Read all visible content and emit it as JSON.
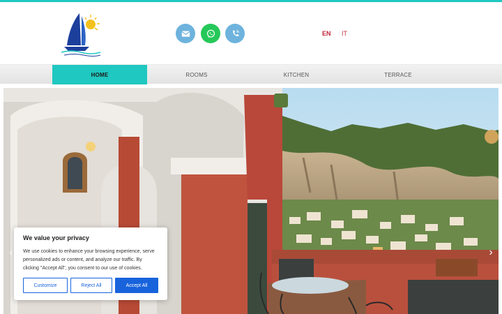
{
  "colors": {
    "accent": "#1fc8c0",
    "language_active": "#c0283c",
    "mail_button": "#6db3dd",
    "whatsapp_button": "#26c85a",
    "phone_button": "#6db3dd",
    "cookie_primary": "#1863dc"
  },
  "header": {
    "logo_icon": "sailboat-sun-logo",
    "contact_icons": [
      "envelope-icon",
      "whatsapp-icon",
      "phone-icon"
    ],
    "languages": [
      {
        "label": "EN",
        "active": true
      },
      {
        "label": "IT",
        "active": false
      }
    ]
  },
  "nav": {
    "items": [
      {
        "label": "HOME",
        "active": true
      },
      {
        "label": "ROOMS",
        "active": false
      },
      {
        "label": "KITCHEN",
        "active": false
      },
      {
        "label": "TERRACE",
        "active": false
      }
    ]
  },
  "slider": {
    "prev_icon": "chevron-left-icon",
    "next_icon": "chevron-right-icon"
  },
  "cookie": {
    "title": "We value your privacy",
    "text": "We use cookies to enhance your browsing experience, serve personalized ads or content, and analyze our traffic. By clicking \"Accept All\", you consent to our use of cookies.",
    "customize_label": "Customize",
    "reject_label": "Reject All",
    "accept_label": "Accept All"
  }
}
